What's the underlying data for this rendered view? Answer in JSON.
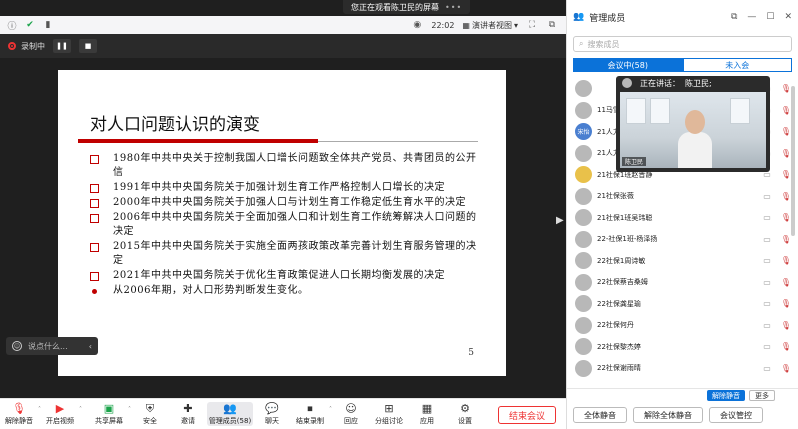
{
  "share_banner": {
    "text": "您正在观看陈卫民的屏幕",
    "dots": "•••"
  },
  "topbar": {
    "time": "22:02",
    "view_label": "演讲者视图"
  },
  "recording": {
    "label": "录制中"
  },
  "slide": {
    "title": "对人口问题认识的演变",
    "bullets": [
      "1980年中共中央关于控制我国人口增长问题致全体共产党员、共青团员的公开信",
      "1991年中共中央国务院关于加强计划生育工作严格控制人口增长的决定",
      "2000年中共中央国务院关于加强人口与计划生育工作稳定低生育水平的决定",
      "2006年中共中央国务院关于全面加强人口和计划生育工作统筹解决人口问题的决定",
      "2015年中共中央国务院关于实施全面两孩政策改革完善计划生育服务管理的决定",
      "2021年中共中央国务院关于优化生育政策促进人口长期均衡发展的决定",
      "从2006年期，对人口形势判断发生变化。"
    ],
    "page_number": "5"
  },
  "chat_input": {
    "placeholder": "说点什么..."
  },
  "toolbar": {
    "items": [
      {
        "label": "解除静音",
        "icon": "mic-muted-icon"
      },
      {
        "label": "开启视频",
        "icon": "camera-off-icon"
      },
      {
        "label": "共享屏幕",
        "icon": "share-screen-icon"
      },
      {
        "label": "安全",
        "icon": "shield-icon"
      },
      {
        "label": "邀请",
        "icon": "invite-icon"
      },
      {
        "label": "管理成员(58)",
        "icon": "members-icon"
      },
      {
        "label": "聊天",
        "icon": "chat-icon"
      },
      {
        "label": "结束录制",
        "icon": "stop-record-icon"
      },
      {
        "label": "回应",
        "icon": "reaction-icon"
      },
      {
        "label": "分组讨论",
        "icon": "breakout-icon"
      },
      {
        "label": "应用",
        "icon": "apps-icon"
      },
      {
        "label": "设置",
        "icon": "settings-icon"
      }
    ],
    "end_meeting": "结束会议"
  },
  "panel": {
    "title": "管理成员",
    "search_placeholder": "搜索成员",
    "tabs": [
      "会议中(58)",
      "未入会"
    ],
    "speaker_label": "正在讲话：",
    "speaker_name": "陈卫民;",
    "speaker_tag": "陈卫民",
    "members": [
      {
        "name": "",
        "avatar": ""
      },
      {
        "name": "11马雪",
        "avatar": ""
      },
      {
        "name": "21人力",
        "avatar": "宋怡"
      },
      {
        "name": "21人力",
        "avatar": ""
      },
      {
        "name": "21社保1班赵晋静",
        "avatar": ""
      },
      {
        "name": "21社保张薇",
        "avatar": ""
      },
      {
        "name": "21社保1班吴玮聪",
        "avatar": ""
      },
      {
        "name": "22-社保1班-杨泽扬",
        "avatar": ""
      },
      {
        "name": "22社保1周诗敏",
        "avatar": ""
      },
      {
        "name": "22社保蔡吉桑姆",
        "avatar": ""
      },
      {
        "name": "22社保龚星瑜",
        "avatar": ""
      },
      {
        "name": "22社保何丹",
        "avatar": ""
      },
      {
        "name": "22社保黎杰婷",
        "avatar": ""
      },
      {
        "name": "22社保谢雨晴",
        "avatar": ""
      }
    ],
    "mute_all_btn": "解除静音",
    "more_btn": "更多",
    "actions": [
      "全体静音",
      "解除全体静音",
      "会议管控"
    ]
  }
}
